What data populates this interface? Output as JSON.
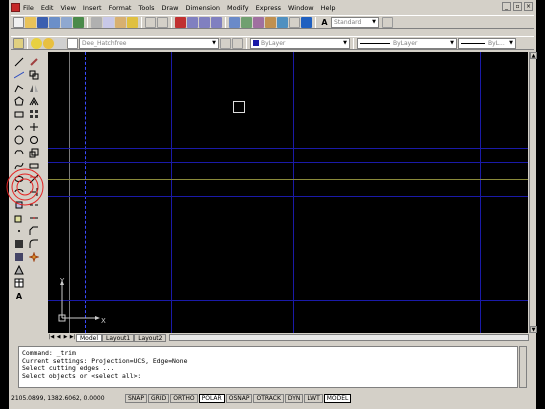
{
  "menu": {
    "items": [
      "File",
      "Edit",
      "View",
      "Insert",
      "Format",
      "Tools",
      "Draw",
      "Dimension",
      "Modify",
      "Express",
      "Window",
      "Help"
    ]
  },
  "toolbar": {
    "text_style": "Standard",
    "workspace_combo": "Dee_Hatchfree",
    "layer_color": "ByLayer",
    "linetype": "ByLayer",
    "lineweight": "ByL..."
  },
  "tabs": [
    "Model",
    "Layout1",
    "Layout2"
  ],
  "ucs": {
    "x_label": "X",
    "y_label": "Y"
  },
  "command": {
    "lines": [
      "Command: _trim",
      "Current settings: Projection=UCS, Edge=None",
      "Select cutting edges ...",
      "Select objects or <select all>:"
    ]
  },
  "status": {
    "coords": "2105.0899, 1382.6062, 0.0000",
    "buttons": [
      "SNAP",
      "GRID",
      "ORTHO",
      "POLAR",
      "OSNAP",
      "OTRACK",
      "DYN",
      "LWT",
      "MODEL"
    ],
    "active": [
      "POLAR",
      "MODEL"
    ]
  },
  "colors": {
    "blue_line": "#1a1aa8",
    "yellow_line": "#8a8a3a",
    "highlight_ring": "#e52222",
    "dashed_line": "#3a4aff"
  },
  "icons": {
    "left_col1": [
      "line-icon",
      "construction-line-icon",
      "polyline-icon",
      "polygon-icon",
      "rectangle-icon",
      "arc-icon",
      "circle-icon",
      "revision-cloud-icon",
      "spline-icon",
      "ellipse-icon",
      "ellipse-arc-icon",
      "insert-block-icon",
      "make-block-icon",
      "point-icon",
      "hatch-icon",
      "gradient-icon",
      "region-icon",
      "table-icon",
      "mtext-icon"
    ],
    "left_col2": [
      "erase-icon",
      "copy-icon",
      "mirror-icon",
      "offset-icon",
      "array-icon",
      "move-icon",
      "rotate-icon",
      "scale-icon",
      "stretch-icon",
      "trim-icon",
      "extend-icon",
      "break-icon",
      "join-icon",
      "chamfer-icon",
      "fillet-icon",
      "explode-icon"
    ]
  }
}
